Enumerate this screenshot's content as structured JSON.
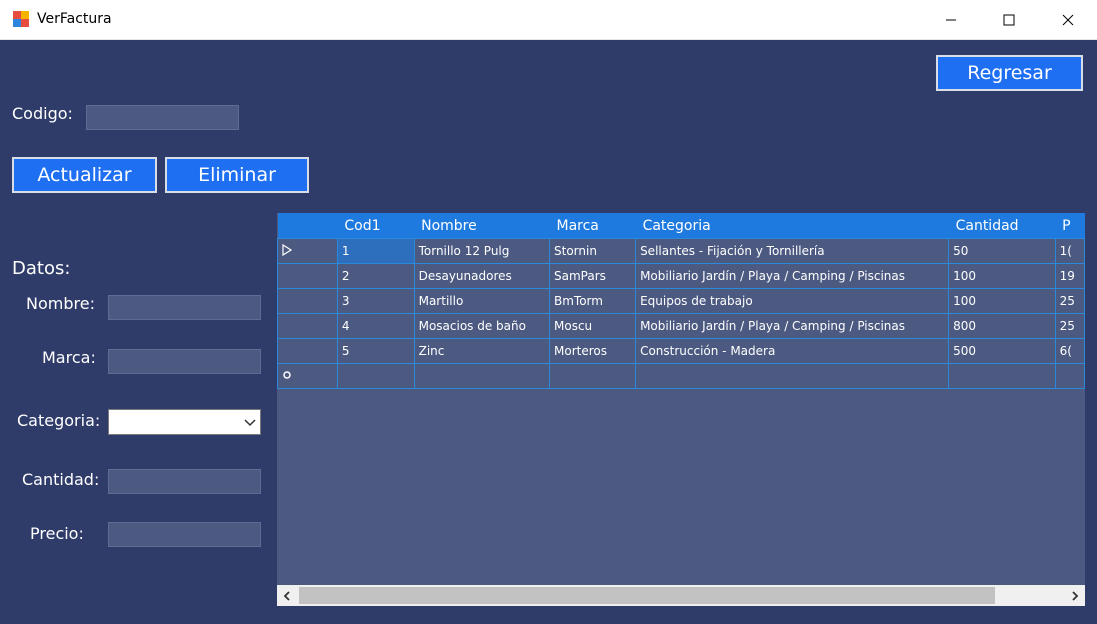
{
  "window": {
    "title": "VerFactura",
    "min_icon": "minimize-icon",
    "max_icon": "maximize-icon",
    "close_icon": "close-icon"
  },
  "form": {
    "regresar": "Regresar",
    "codigo_label": "Codigo:",
    "codigo_value": "",
    "actualizar": "Actualizar",
    "eliminar": "Eliminar",
    "datos_label": "Datos:",
    "nombre_label": "Nombre:",
    "marca_label": "Marca:",
    "categoria_label": "Categoria:",
    "cantidad_label": "Cantidad:",
    "precio_label": "Precio:"
  },
  "grid": {
    "columns": [
      "Cod1",
      "Nombre",
      "Marca",
      "Categoria",
      "Cantidad",
      "P"
    ],
    "rows": [
      [
        "1",
        "Tornillo 12 Pulg",
        "Stornin",
        "Sellantes - Fijación y Tornillería",
        "50",
        "1("
      ],
      [
        "2",
        "Desayunadores",
        "SamPars",
        "Mobiliario Jardín / Playa / Camping / Piscinas",
        "100",
        "19"
      ],
      [
        "3",
        "Martillo",
        "BmTorm",
        "Equipos de trabajo",
        "100",
        "25"
      ],
      [
        "4",
        "Mosacios de baño",
        "Moscu",
        "Mobiliario Jardín / Playa / Camping / Piscinas",
        "800",
        "25"
      ],
      [
        "5",
        "Zinc",
        "Morteros",
        "Construcción - Madera",
        "500",
        "6("
      ]
    ]
  },
  "colors": {
    "background": "#2f3c6a",
    "button": "#1f6ff2",
    "header": "#1f7ae0",
    "field": "#4c5a82"
  }
}
